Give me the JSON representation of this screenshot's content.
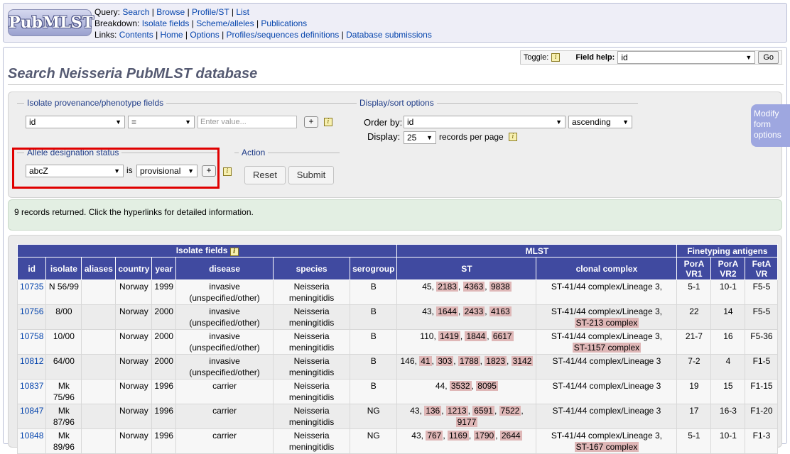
{
  "header": {
    "logo_text": "PubMLST",
    "query_label": "Query:",
    "query_links": [
      "Search",
      "Browse",
      "Profile/ST",
      "List"
    ],
    "breakdown_label": "Breakdown:",
    "breakdown_links": [
      "Isolate fields",
      "Scheme/alleles",
      "Publications"
    ],
    "links_label": "Links:",
    "links_links": [
      "Contents",
      "Home",
      "Options",
      "Profiles/sequences definitions",
      "Database submissions"
    ]
  },
  "toolbar": {
    "toggle_label": "Toggle:",
    "field_help_label": "Field help:",
    "field_help_value": "id",
    "go_label": "Go"
  },
  "page_title": "Search Neisseria PubMLST database",
  "form": {
    "provenance_legend": "Isolate provenance/phenotype fields",
    "provenance_field": "id",
    "provenance_operator": "=",
    "provenance_placeholder": "Enter value...",
    "display_legend": "Display/sort options",
    "order_by_label": "Order by:",
    "order_by_value": "id",
    "order_dir_value": "ascending",
    "display_label": "Display:",
    "display_value": "25",
    "records_per_page": "records per page",
    "allele_legend": "Allele designation status",
    "allele_locus": "abcZ",
    "allele_is": "is",
    "allele_status": "provisional",
    "action_legend": "Action",
    "reset_label": "Reset",
    "submit_label": "Submit",
    "modify_label": "Modify form options",
    "plus_label": "+"
  },
  "records_message": "9 records returned. Click the hyperlinks for detailed information.",
  "table": {
    "group_headers": [
      "Isolate fields",
      "MLST",
      "Finetyping antigens"
    ],
    "columns": [
      "id",
      "isolate",
      "aliases",
      "country",
      "year",
      "disease",
      "species",
      "serogroup",
      "ST",
      "clonal complex",
      "PorA VR1",
      "PorA VR2",
      "FetA VR"
    ],
    "rows": [
      {
        "id": "10735",
        "isolate": "N 56/99",
        "aliases": "",
        "country": "Norway",
        "year": "1999",
        "disease": "invasive (unspecified/other)",
        "species": "Neisseria meningitidis",
        "serogroup": "B",
        "st_plain": "45",
        "st_hl": [
          "2183",
          "4363",
          "9838"
        ],
        "cc_plain": "ST-41/44 complex/Lineage 3,",
        "cc_hl": "",
        "vr1": "5-1",
        "vr2": "10-1",
        "feta": "F5-5"
      },
      {
        "id": "10756",
        "isolate": "8/00",
        "aliases": "",
        "country": "Norway",
        "year": "2000",
        "disease": "invasive (unspecified/other)",
        "species": "Neisseria meningitidis",
        "serogroup": "B",
        "st_plain": "43",
        "st_hl": [
          "1644",
          "2433",
          "4163"
        ],
        "cc_plain": "ST-41/44 complex/Lineage 3,",
        "cc_hl": "ST-213 complex",
        "vr1": "22",
        "vr2": "14",
        "feta": "F5-5"
      },
      {
        "id": "10758",
        "isolate": "10/00",
        "aliases": "",
        "country": "Norway",
        "year": "2000",
        "disease": "invasive (unspecified/other)",
        "species": "Neisseria meningitidis",
        "serogroup": "B",
        "st_plain": "110",
        "st_hl": [
          "1419",
          "1844",
          "6617"
        ],
        "cc_plain": "ST-41/44 complex/Lineage 3,",
        "cc_hl": "ST-1157 complex",
        "vr1": "21-7",
        "vr2": "16",
        "feta": "F5-36"
      },
      {
        "id": "10812",
        "isolate": "64/00",
        "aliases": "",
        "country": "Norway",
        "year": "2000",
        "disease": "invasive (unspecified/other)",
        "species": "Neisseria meningitidis",
        "serogroup": "B",
        "st_plain": "146",
        "st_hl": [
          "41",
          "303",
          "1788",
          "1823",
          "3142"
        ],
        "cc_plain": "ST-41/44 complex/Lineage 3",
        "cc_hl": "",
        "vr1": "7-2",
        "vr2": "4",
        "feta": "F1-5"
      },
      {
        "id": "10837",
        "isolate": "Mk 75/96",
        "aliases": "",
        "country": "Norway",
        "year": "1996",
        "disease": "carrier",
        "species": "Neisseria meningitidis",
        "serogroup": "B",
        "st_plain": "44",
        "st_hl": [
          "3532",
          "8095"
        ],
        "cc_plain": "ST-41/44 complex/Lineage 3",
        "cc_hl": "",
        "vr1": "19",
        "vr2": "15",
        "feta": "F1-15"
      },
      {
        "id": "10847",
        "isolate": "Mk 87/96",
        "aliases": "",
        "country": "Norway",
        "year": "1996",
        "disease": "carrier",
        "species": "Neisseria meningitidis",
        "serogroup": "NG",
        "st_plain": "43",
        "st_hl": [
          "136",
          "1213",
          "6591",
          "7522",
          "9177"
        ],
        "cc_plain": "ST-41/44 complex/Lineage 3",
        "cc_hl": "",
        "vr1": "17",
        "vr2": "16-3",
        "feta": "F1-20"
      },
      {
        "id": "10848",
        "isolate": "Mk 89/96",
        "aliases": "",
        "country": "Norway",
        "year": "1996",
        "disease": "carrier",
        "species": "Neisseria meningitidis",
        "serogroup": "NG",
        "st_plain": "43",
        "st_hl": [
          "767",
          "1169",
          "1790",
          "2644"
        ],
        "cc_plain": "ST-41/44 complex/Lineage 3,",
        "cc_hl": "ST-167 complex",
        "vr1": "5-1",
        "vr2": "10-1",
        "feta": "F1-3"
      }
    ]
  },
  "colors": {
    "header_bg": "#404aa0",
    "highlight_cell": "#dfb7b7",
    "annotation_box": "#e00000"
  }
}
